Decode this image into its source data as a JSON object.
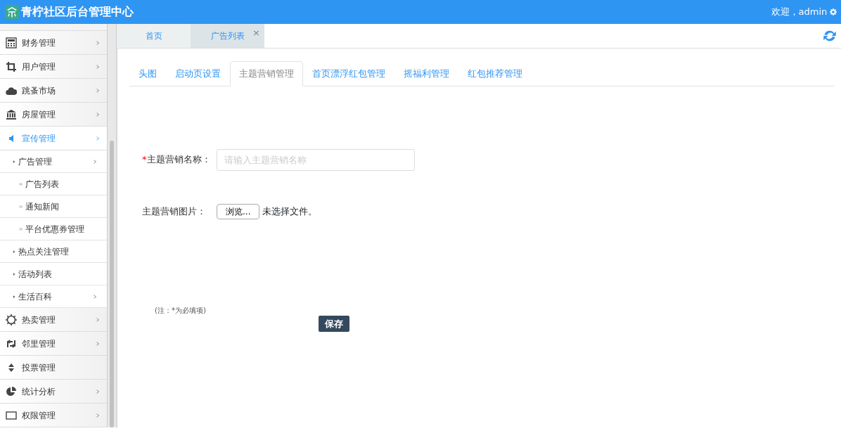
{
  "header": {
    "title": "青柠社区后台管理中心",
    "welcome": "欢迎，admin"
  },
  "sidebar": {
    "items": [
      {
        "label": "财务管理",
        "expandable": true,
        "selected": false
      },
      {
        "label": "用户管理",
        "expandable": true,
        "selected": false
      },
      {
        "label": "跳蚤市场",
        "expandable": true,
        "selected": false
      },
      {
        "label": "房屋管理",
        "expandable": true,
        "selected": false
      },
      {
        "label": "宣传管理",
        "expandable": true,
        "selected": true,
        "children": [
          {
            "label": "广告管理",
            "expandable": true,
            "children": [
              {
                "label": "广告列表"
              },
              {
                "label": "通知新闻"
              },
              {
                "label": "平台优惠券管理"
              }
            ]
          },
          {
            "label": "热点关注管理",
            "expandable": false
          },
          {
            "label": "活动列表",
            "expandable": false
          },
          {
            "label": "生活百科",
            "expandable": true
          }
        ]
      },
      {
        "label": "热卖管理",
        "expandable": true,
        "selected": false
      },
      {
        "label": "邻里管理",
        "expandable": true,
        "selected": false
      },
      {
        "label": "投票管理",
        "expandable": false,
        "selected": false
      },
      {
        "label": "统计分析",
        "expandable": true,
        "selected": false
      },
      {
        "label": "权限管理",
        "expandable": true,
        "selected": false
      }
    ]
  },
  "page_tabs": [
    {
      "label": "首页",
      "selected": false
    },
    {
      "label": "广告列表",
      "selected": true,
      "close": "×"
    }
  ],
  "tabs": [
    {
      "label": "头图",
      "selected": false
    },
    {
      "label": "启动页设置",
      "selected": false
    },
    {
      "label": "主题营销管理",
      "selected": true
    },
    {
      "label": "首页漂浮红包管理",
      "selected": false
    },
    {
      "label": "摇福利管理",
      "selected": false
    },
    {
      "label": "红包推荐管理",
      "selected": false
    }
  ],
  "form": {
    "name_field": {
      "label": "主题营销名称：",
      "required": true,
      "required_mark": "*",
      "placeholder": "请输入主题营销名称"
    },
    "image_field": {
      "label": "主题营销图片：",
      "button": "浏览...",
      "status": "未选择文件。"
    },
    "note": "(注：*为必填项)",
    "save": "保存"
  }
}
